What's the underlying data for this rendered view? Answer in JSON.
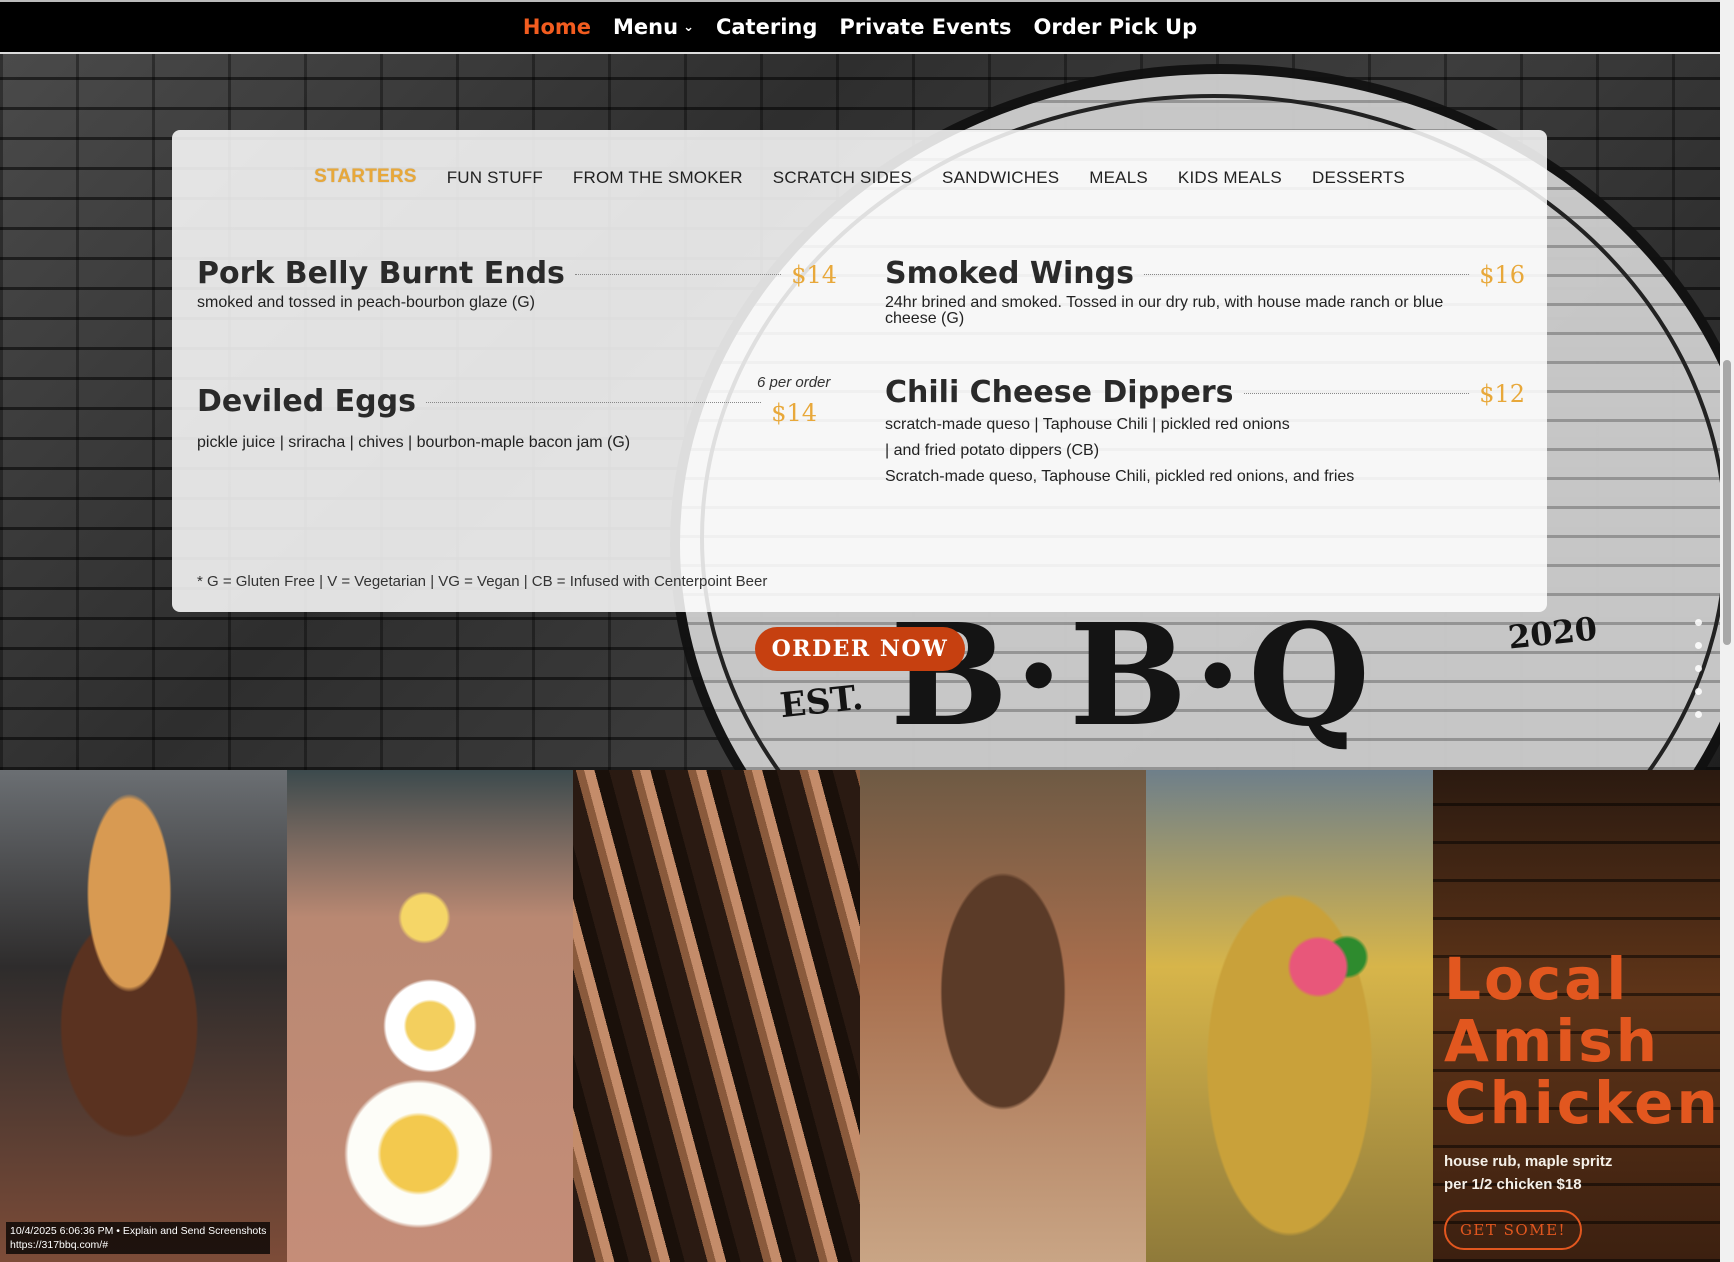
{
  "nav": {
    "items": [
      {
        "label": "Home",
        "active": true
      },
      {
        "label": "Menu"
      },
      {
        "label": "Catering"
      },
      {
        "label": "Private Events"
      },
      {
        "label": "Order Pick Up"
      }
    ]
  },
  "hero": {
    "barrel": {
      "est": "EST.",
      "logo": "B·B·Q",
      "year": "2020"
    }
  },
  "menu": {
    "tabs": [
      "STARTERS",
      "FUN STUFF",
      "FROM THE SMOKER",
      "SCRATCH SIDES",
      "SANDWICHES",
      "MEALS",
      "KIDS MEALS",
      "DESSERTS"
    ],
    "active_tab": "STARTERS",
    "items": [
      {
        "name": "Pork Belly Burnt Ends",
        "price": "$14",
        "description": "smoked and tossed in peach-bourbon glaze (G)"
      },
      {
        "name": "Smoked Wings",
        "price": "$16",
        "description": "24hr brined and smoked. Tossed in our dry rub, with house made ranch or blue cheese (G)"
      },
      {
        "name": "Deviled Eggs",
        "price": "$14",
        "note": "6 per order",
        "description": "pickle juice | sriracha | chives | bourbon-maple bacon jam (G)"
      },
      {
        "name": "Chili Cheese Dippers",
        "price": "$12",
        "description_lines": [
          "scratch-made queso | Taphouse Chili | pickled red onions",
          "| and fried potato dippers (CB)",
          "Scratch-made queso, Taphouse Chili, pickled red onions, and fries"
        ]
      }
    ],
    "legend": "* G = Gluten Free  |  V = Vegetarian  |  VG = Vegan  |  CB = Infused with Centerpoint Beer"
  },
  "order_button": "ORDER NOW",
  "promo": {
    "title_lines": [
      "Local",
      "Amish",
      "Chicken"
    ],
    "lines": [
      "house rub, maple spritz",
      "per 1/2 chicken $18"
    ],
    "button": "GET SOME!"
  },
  "status": {
    "line1": "10/4/2025 6:06:36 PM • Explain and Send Screenshots",
    "line2": "https://317bbq.com/#"
  },
  "colors": {
    "accent": "#f25c1f",
    "gold": "#e8a83a",
    "button": "#c64010"
  }
}
